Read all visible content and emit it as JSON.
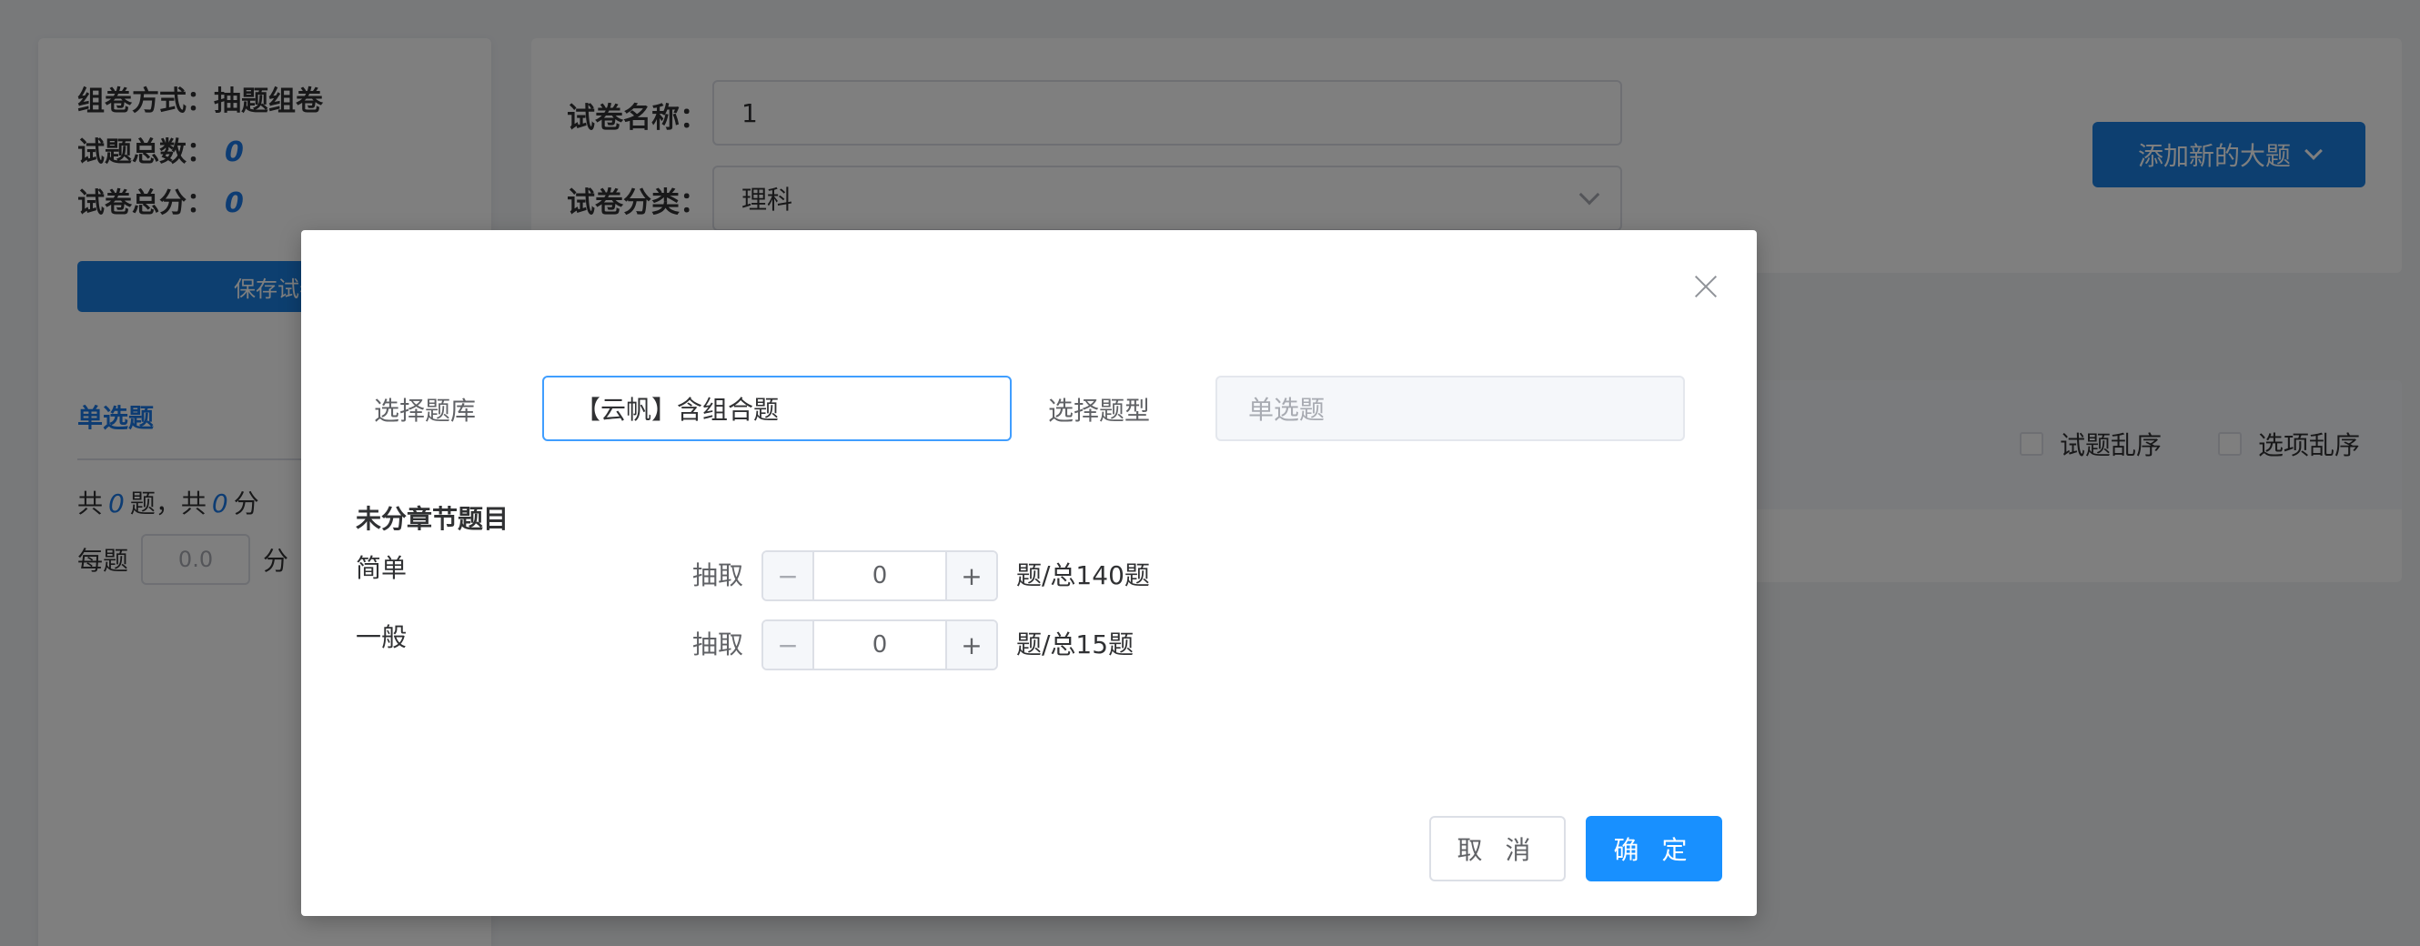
{
  "left_panel": {
    "method_label": "组卷方式：",
    "method_value": "抽题组卷",
    "total_questions_label": "试题总数：",
    "total_questions_value": "0",
    "total_score_label": "试卷总分：",
    "total_score_value": "0",
    "save_button": "保存试卷",
    "section_name": "单选题",
    "count_prefix": "共",
    "count_q": "0",
    "count_mid": "题，共",
    "count_score": "0",
    "count_suffix": "分",
    "per_label": "每题",
    "per_value": "0.0",
    "per_unit": "分"
  },
  "top_form": {
    "name_label": "试卷名称：",
    "name_value": "1",
    "category_label": "试卷分类：",
    "category_value": "理科",
    "add_button": "添加新的大题"
  },
  "list_header": {
    "shuffle_questions": "试题乱序",
    "shuffle_options": "选项乱序"
  },
  "dialog": {
    "bank_label": "选择题库",
    "bank_value": "【云帆】含组合题",
    "type_label": "选择题型",
    "type_placeholder": "单选题",
    "chapter_title": "未分章节题目",
    "draw_label": "抽取",
    "rows": [
      {
        "difficulty": "简单",
        "value": "0",
        "total": "题/总140题"
      },
      {
        "difficulty": "一般",
        "value": "0",
        "total": "题/总15题"
      }
    ],
    "minus_symbol": "−",
    "plus_symbol": "+",
    "cancel_button": "取 消",
    "ok_button": "确 定"
  },
  "colors": {
    "primary": "#1890ff",
    "link": "#1a79e6",
    "overlay": "rgba(0,0,0,0.5)"
  },
  "icons": [
    "close-icon",
    "chevron-down-icon",
    "minus-icon",
    "plus-icon",
    "checkbox-icon"
  ]
}
